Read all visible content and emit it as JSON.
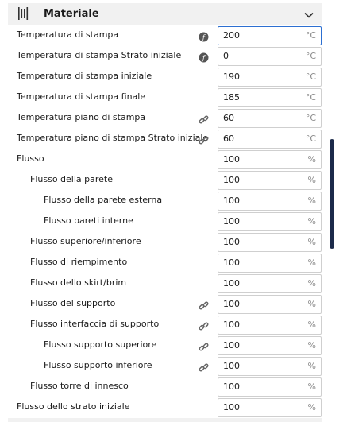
{
  "section": {
    "title": "Materiale",
    "icon": "material-spool-icon",
    "toggle_icon": "chevron-down-icon"
  },
  "settings": [
    {
      "label": "Temperatura di stampa",
      "value": "200",
      "unit": "°C",
      "icon": "function-icon",
      "indent": 0,
      "active": true
    },
    {
      "label": "Temperatura di stampa Strato iniziale",
      "value": "0",
      "unit": "°C",
      "icon": "function-icon",
      "indent": 0
    },
    {
      "label": "Temperatura di stampa iniziale",
      "value": "190",
      "unit": "°C",
      "icon": "",
      "indent": 0
    },
    {
      "label": "Temperatura di stampa finale",
      "value": "185",
      "unit": "°C",
      "icon": "",
      "indent": 0
    },
    {
      "label": "Temperatura piano di stampa",
      "value": "60",
      "unit": "°C",
      "icon": "link-icon",
      "indent": 0
    },
    {
      "label": "Temperatura piano di stampa Strato iniziale",
      "value": "60",
      "unit": "°C",
      "icon": "link-icon",
      "indent": 0
    },
    {
      "label": "Flusso",
      "value": "100",
      "unit": "%",
      "icon": "",
      "indent": 0
    },
    {
      "label": "Flusso della parete",
      "value": "100",
      "unit": "%",
      "icon": "",
      "indent": 1
    },
    {
      "label": "Flusso della parete esterna",
      "value": "100",
      "unit": "%",
      "icon": "",
      "indent": 2
    },
    {
      "label": "Flusso pareti interne",
      "value": "100",
      "unit": "%",
      "icon": "",
      "indent": 2
    },
    {
      "label": "Flusso superiore/inferiore",
      "value": "100",
      "unit": "%",
      "icon": "",
      "indent": 1
    },
    {
      "label": "Flusso di riempimento",
      "value": "100",
      "unit": "%",
      "icon": "",
      "indent": 1
    },
    {
      "label": "Flusso dello skirt/brim",
      "value": "100",
      "unit": "%",
      "icon": "",
      "indent": 1
    },
    {
      "label": "Flusso del supporto",
      "value": "100",
      "unit": "%",
      "icon": "link-icon",
      "indent": 1
    },
    {
      "label": "Flusso interfaccia di supporto",
      "value": "100",
      "unit": "%",
      "icon": "link-icon",
      "indent": 1
    },
    {
      "label": "Flusso supporto superiore",
      "value": "100",
      "unit": "%",
      "icon": "link-icon",
      "indent": 2
    },
    {
      "label": "Flusso supporto inferiore",
      "value": "100",
      "unit": "%",
      "icon": "link-icon",
      "indent": 2
    },
    {
      "label": "Flusso torre di innesco",
      "value": "100",
      "unit": "%",
      "icon": "",
      "indent": 1
    },
    {
      "label": "Flusso dello strato iniziale",
      "value": "100",
      "unit": "%",
      "icon": "",
      "indent": 0
    }
  ],
  "colors": {
    "accent": "#2c6fd1",
    "header_bg": "#f1f1f1",
    "scrollbar": "#1c2a4a"
  }
}
